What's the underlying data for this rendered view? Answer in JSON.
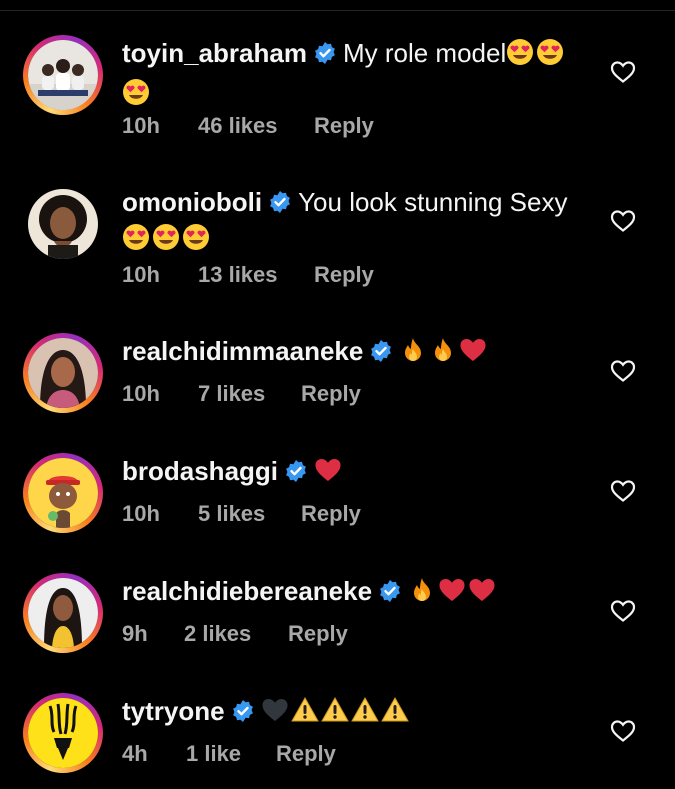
{
  "colors": {
    "background": "#000000",
    "text": "#f5f5f5",
    "meta": "#a8a8a8",
    "verified": "#3897f0"
  },
  "comments": [
    {
      "username": "toyin_abraham",
      "text": "My role model",
      "emoji": [
        "heart-eyes-emoji",
        "heart-eyes-emoji",
        "heart-eyes-emoji"
      ],
      "time": "10h",
      "likes": "46 likes",
      "reply": "Reply"
    },
    {
      "username": "omonioboli",
      "text": "You look stunning Sexy",
      "emoji": [
        "heart-eyes-emoji",
        "heart-eyes-emoji",
        "heart-eyes-emoji"
      ],
      "time": "10h",
      "likes": "13 likes",
      "reply": "Reply"
    },
    {
      "username": "realchidimmaaneke",
      "text": "",
      "emoji": [
        "fire-emoji",
        "fire-emoji",
        "red-heart-emoji"
      ],
      "time": "10h",
      "likes": "7 likes",
      "reply": "Reply"
    },
    {
      "username": "brodashaggi",
      "text": "",
      "emoji": [
        "red-heart-emoji"
      ],
      "time": "10h",
      "likes": "5 likes",
      "reply": "Reply"
    },
    {
      "username": "realchidiebereaneke",
      "text": "",
      "emoji": [
        "fire-emoji",
        "red-heart-emoji",
        "red-heart-emoji"
      ],
      "time": "9h",
      "likes": "2 likes",
      "reply": "Reply"
    },
    {
      "username": "tytryone",
      "text": "",
      "emoji": [
        "black-heart-emoji",
        "warning-emoji",
        "warning-emoji",
        "warning-emoji",
        "warning-emoji"
      ],
      "time": "4h",
      "likes": "1 like",
      "reply": "Reply"
    }
  ]
}
